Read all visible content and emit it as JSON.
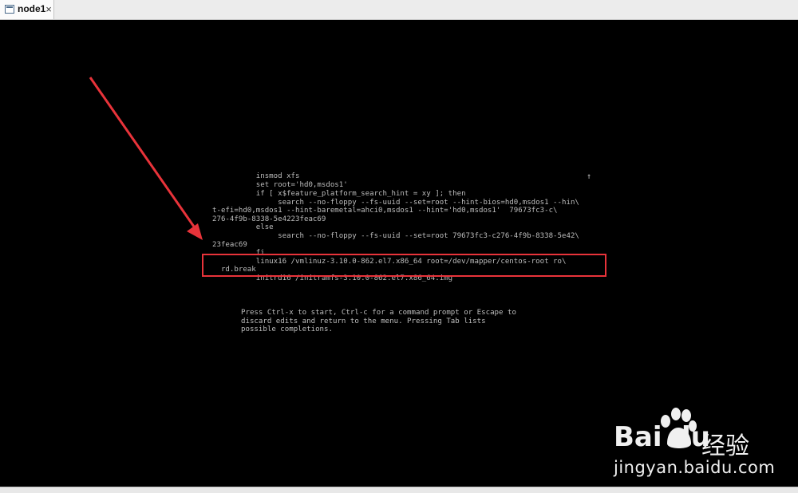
{
  "tab": {
    "label": "node1",
    "close": "×"
  },
  "terminal": {
    "lines": [
      "          insmod xfs",
      "          set root='hd0,msdos1'",
      "          if [ x$feature_platform_search_hint = xy ]; then",
      "               search --no-floppy --fs-uuid --set=root --hint-bios=hd0,msdos1 --hin\\",
      "t-efi=hd0,msdos1 --hint-baremetal=ahci0,msdos1 --hint='hd0,msdos1'  79673fc3-c\\",
      "276-4f9b-8338-5e4223feac69",
      "          else",
      "               search --no-floppy --fs-uuid --set=root 79673fc3-c276-4f9b-8338-5e42\\",
      "23feac69",
      "          fi",
      "          linux16 /vmlinuz-3.10.0-862.el7.x86_64 root=/dev/mapper/centos-root ro\\",
      "  rd.break",
      "          initrd16 /initramfs-3.10.0-862.el7.x86_64.img"
    ],
    "scroll_indicator": "↑",
    "help": [
      "Press Ctrl-x to start, Ctrl-c for a command prompt or Escape to",
      "discard edits and return to the menu. Pressing Tab lists",
      "possible completions."
    ]
  },
  "watermark": {
    "logo": "Bai du",
    "cn": "经验",
    "url": "jingyan.baidu.com"
  },
  "annotation_color": "#e8333a"
}
